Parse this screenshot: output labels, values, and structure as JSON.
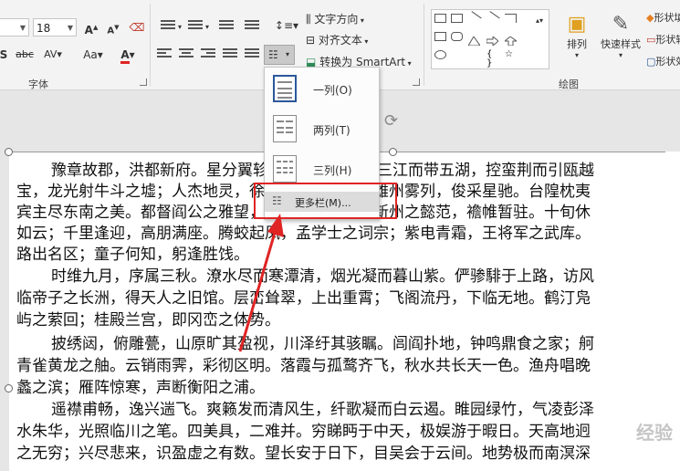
{
  "ribbon": {
    "font_name": "",
    "font_size": "18",
    "text_direction": "文字方向",
    "align_text": "对齐文本",
    "convert_smartart": "转换为 SmartArt",
    "arrange": "排列",
    "quick_styles": "快速样式",
    "shape_fill": "形状填充",
    "shape_outline": "形状轮廓",
    "shape_effects": "形状效果",
    "group_font": "字体",
    "group_drawing": "绘图"
  },
  "columns_menu": {
    "one_column": "一列(O)",
    "two_columns": "两列(T)",
    "three_columns": "三列(H)",
    "more_columns": "更多栏(M)..."
  },
  "document": {
    "lines": [
      "豫章故郡，洪都新府。星分翼轸，地接衡庐。襟三江而带五湖，控蛮荆而引瓯越",
      "宝，龙光射牛斗之墟；人杰地灵，徐孺下陈蕃之榻。雄州雾列，俊采星驰。台隍枕夷",
      "宾主尽东南之美。都督阎公之雅望，棨戟遥临；宇文新州之懿范，襜帷暂驻。十旬休",
      "如云；千里逢迎，高朋满座。腾蛟起凤，孟学士之词宗；紫电青霜，王将军之武库。",
      "路出名区；童子何知，躬逢胜饯。",
      "时维九月，序属三秋。潦水尽而寒潭清，烟光凝而暮山紫。俨骖騑于上路，访风",
      "临帝子之长洲，得天人之旧馆。层峦耸翠，上出重霄；飞阁流丹，下临无地。鹤汀凫",
      "屿之萦回；桂殿兰宫，即冈峦之体势。",
      "披绣闼，俯雕甍，山原旷其盈视，川泽纡其骇瞩。闾阎扑地，钟鸣鼎食之家；舸",
      "青雀黄龙之舳。云销雨霁，彩彻区明。落霞与孤鹜齐飞，秋水共长天一色。渔舟唱晚",
      "蠡之滨；雁阵惊寒，声断衡阳之浦。",
      "遥襟甫畅，逸兴遄飞。爽籁发而清风生，纤歌凝而白云遏。睢园绿竹，气凌彭泽",
      "水朱华，光照临川之笔。四美具，二难并。穷睇眄于中天，极娱游于暇日。天高地迥",
      "之无穷；兴尽悲来，识盈虚之有数。望长安于日下，目吴会于云间。地势极而南溟深"
    ]
  },
  "watermark": "经验",
  "colors": {
    "highlight_red": "#e02424",
    "font_color_red": "#e02424",
    "accent": "#2b579a"
  }
}
